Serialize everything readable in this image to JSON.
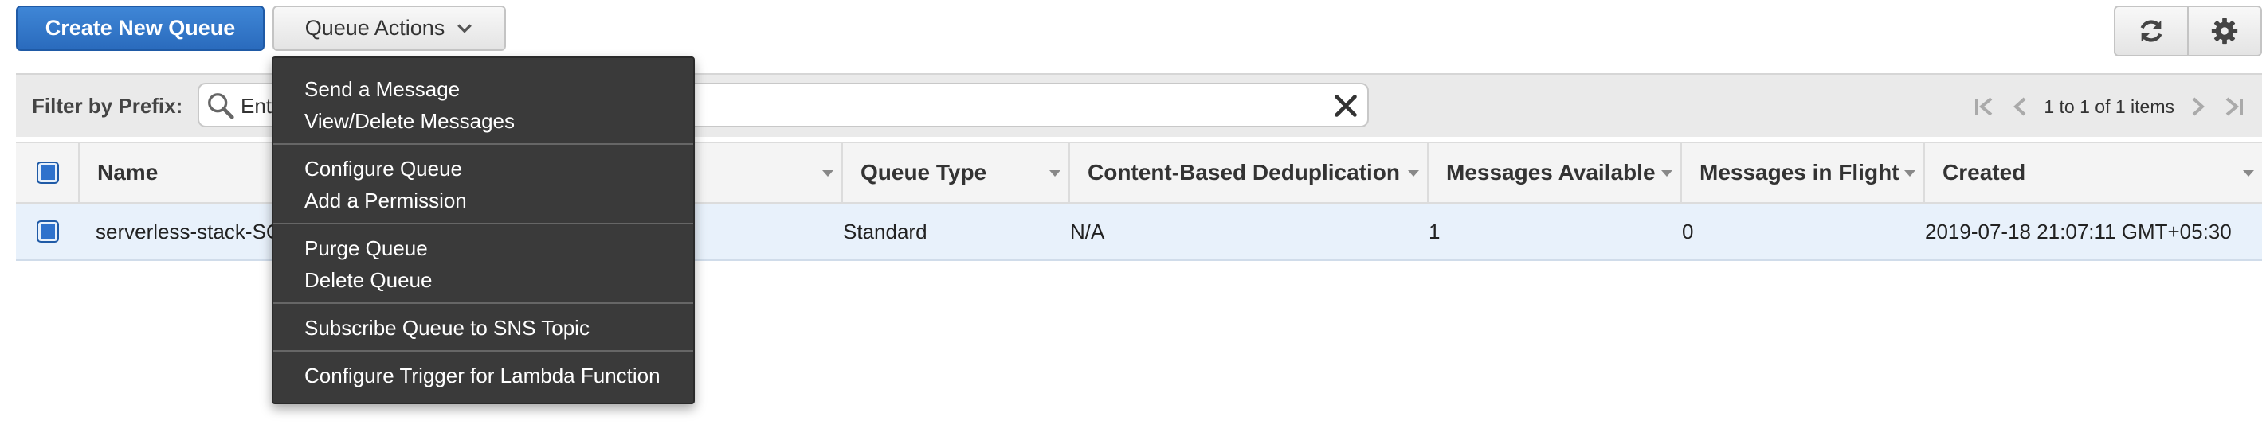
{
  "toolbar": {
    "create_label": "Create New Queue",
    "actions_label": "Queue Actions"
  },
  "filter": {
    "label": "Filter by Prefix:",
    "input_value": "Ent",
    "pager_text": "1 to 1 of 1 items"
  },
  "table": {
    "columns": [
      "Name",
      "Queue Type",
      "Content-Based Deduplication",
      "Messages Available",
      "Messages in Flight",
      "Created"
    ],
    "rows": [
      {
        "name": "serverless-stack-SC",
        "queue_type": "Standard",
        "dedup": "N/A",
        "available": "1",
        "in_flight": "0",
        "created": "2019-07-18 21:07:11 GMT+05:30"
      }
    ]
  },
  "menu": {
    "items": [
      "Send a Message",
      "View/Delete Messages",
      "Configure Queue",
      "Add a Permission",
      "Purge Queue",
      "Delete Queue",
      "Subscribe Queue to SNS Topic",
      "Configure Trigger for Lambda Function"
    ]
  },
  "colors": {
    "primary": "#2a6bbd",
    "menu_bg": "#3a3a3a",
    "row_selected": "#e8f1fb"
  }
}
